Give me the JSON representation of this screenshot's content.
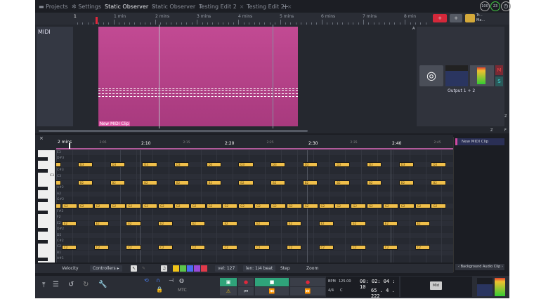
{
  "tabs": [
    {
      "label": "Projects",
      "icon": "folder-icon"
    },
    {
      "label": "Settings",
      "icon": "gear-icon"
    },
    {
      "label": "Static Observer",
      "active": true
    },
    {
      "label": "Static Observer"
    },
    {
      "label": "Testing Edit 2"
    },
    {
      "label": "Testing Edit 2"
    }
  ],
  "tab_close": "×",
  "tab_add": "+",
  "status_badges": [
    "100",
    "23"
  ],
  "ruler": {
    "start": "1",
    "labels": [
      "1 min",
      "2 mins",
      "3 mins",
      "4 mins",
      "5 mins",
      "6 mins",
      "7 mins",
      "8 min"
    ]
  },
  "toolbar_right": {
    "add_red": "+",
    "add": "+",
    "mini_labels": [
      "Tr...",
      "Ma..."
    ]
  },
  "track": {
    "name": "MIDI",
    "clip_name": "New MIDI Clip",
    "output": "Output 1 + 2",
    "mute": "M",
    "solo": "S",
    "zoom_labels": [
      "A",
      "Z",
      "Z",
      "F"
    ]
  },
  "piano_roll": {
    "close": "×",
    "time_labels": [
      {
        "t": 120,
        "label": "2 mins"
      },
      {
        "t": 125,
        "label": "2:05"
      },
      {
        "t": 130,
        "label": "2:10"
      },
      {
        "t": 135,
        "label": "2:15"
      },
      {
        "t": 140,
        "label": "2:20"
      },
      {
        "t": 145,
        "label": "2:25"
      },
      {
        "t": 150,
        "label": "2:30"
      },
      {
        "t": 155,
        "label": "2:35"
      },
      {
        "t": 160,
        "label": "2:40"
      },
      {
        "t": 165,
        "label": "2:45"
      }
    ],
    "playhead_time": 121.5,
    "rows": [
      "E3",
      "D#3",
      "D3",
      "C#3",
      "C3",
      "B2",
      "A#2",
      "A2",
      "G#2",
      "G2",
      "F#2",
      "F2",
      "E2",
      "D#2",
      "D2",
      "C#2",
      "C2",
      "B1",
      "A#1"
    ],
    "key_label": "C3",
    "notes": [
      {
        "pitch": "D3",
        "length": 1.8,
        "starts": [
          118.75,
          122.59,
          126.43,
          130.27,
          134.11,
          137.95,
          141.79,
          145.63,
          149.47,
          153.31,
          157.15,
          160.99,
          164.83
        ]
      },
      {
        "pitch": "B2",
        "length": 1.8,
        "starts": [
          118.75,
          122.59,
          126.43,
          130.27,
          134.11,
          137.95,
          141.79,
          145.63,
          149.47,
          153.31,
          157.15,
          160.99,
          164.83
        ]
      },
      {
        "pitch": "G2",
        "length": 1.85,
        "starts": [
          118.75,
          120.67,
          122.59,
          124.51,
          126.43,
          128.35,
          130.27,
          132.19,
          134.11,
          136.03,
          137.95,
          139.87,
          141.79,
          143.71,
          145.63,
          147.55,
          149.47,
          151.39,
          153.31,
          155.23,
          157.15,
          159.07,
          160.99,
          162.91,
          164.83
        ]
      },
      {
        "pitch": "E2",
        "length": 1.8,
        "starts": [
          120.67,
          124.51,
          128.35,
          132.19,
          136.03,
          139.87,
          143.71,
          147.55,
          151.39,
          155.23,
          159.07,
          162.91
        ]
      },
      {
        "pitch": "C2",
        "length": 1.8,
        "starts": [
          120.67,
          124.51,
          128.35,
          132.19,
          136.03,
          139.87,
          143.71,
          147.55,
          151.39,
          155.23,
          159.07,
          162.91
        ]
      }
    ],
    "toolbar": {
      "velocity": "Velocity",
      "controllers": "Controllers",
      "controllers_arrow": "▸",
      "vel": "vel: 127",
      "len": "len: 1/4 beat",
      "step": "Step",
      "zoom": "Zoom"
    },
    "colors": [
      "#f0c419",
      "#5cc44a",
      "#4a6cf0",
      "#9a4ad8",
      "#e03a4a"
    ],
    "side_clip": "New MIDI Clip",
    "side_footer": "‹ Background Audio Clip ›"
  },
  "transport": {
    "mtc": "MTC",
    "bpm_label": "BPM",
    "bpm": "125.00",
    "time_sig": "4/4",
    "key": "C",
    "time": "00: 02: 04 : 10",
    "bars": "65 . 4 . 222",
    "midi_badge": "Mid"
  },
  "colors": {
    "clip": "#c24a93",
    "note": "#f0bf4a",
    "accent_green": "#2fa37a",
    "record": "#e0283c"
  }
}
